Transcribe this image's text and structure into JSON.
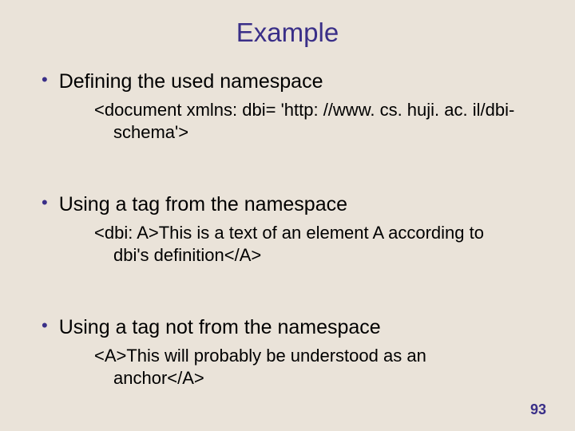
{
  "title": "Example",
  "bullets": [
    {
      "label": "Defining the used namespace",
      "sub_line1": "<document xmlns: dbi= 'http: //www. cs. huji. ac. il/dbi-",
      "sub_line2": "schema'>"
    },
    {
      "label": "Using a tag from the namespace",
      "sub_line1": "<dbi: A>This is a text of an element A according to",
      "sub_line2": "dbi's definition</A>"
    },
    {
      "label": "Using a tag not from the namespace",
      "sub_line1": "<A>This will probably be understood as an",
      "sub_line2": "anchor</A>"
    }
  ],
  "page_number": "93"
}
